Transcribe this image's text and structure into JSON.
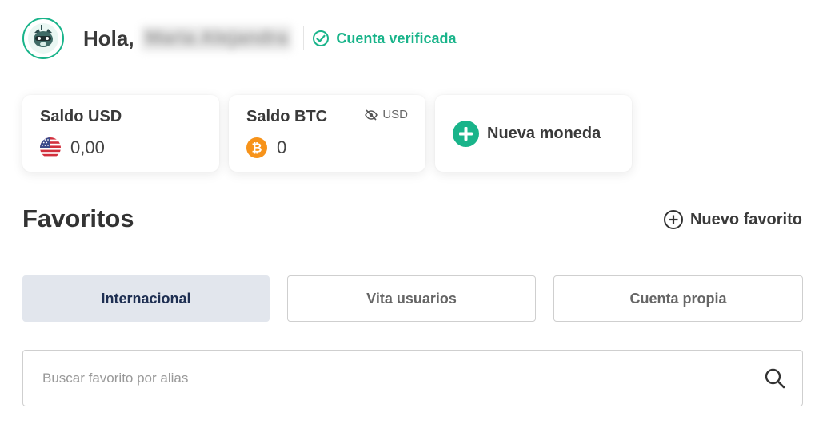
{
  "header": {
    "greeting": "Hola,",
    "user_name": "Maria Alejandra",
    "verified_label": "Cuenta verificada"
  },
  "balances": [
    {
      "title": "Saldo USD",
      "amount": "0,00",
      "icon": "us-flag-icon"
    },
    {
      "title": "Saldo BTC",
      "amount": "0",
      "icon": "bitcoin-icon",
      "toggle_label": "USD",
      "toggle_icon": "eye-slash-icon"
    }
  ],
  "new_currency": {
    "label": "Nueva moneda",
    "icon": "plus-circle-icon"
  },
  "favorites": {
    "title": "Favoritos",
    "new_label": "Nuevo favorito",
    "tabs": [
      {
        "label": "Internacional",
        "active": true
      },
      {
        "label": "Vita usuarios",
        "active": false
      },
      {
        "label": "Cuenta propia",
        "active": false
      }
    ],
    "search_placeholder": "Buscar favorito por alias"
  },
  "colors": {
    "accent_green": "#19b48a",
    "bitcoin_orange": "#f7931a",
    "active_tab_bg": "#e2e6ed",
    "active_tab_text": "#1e2f52"
  }
}
